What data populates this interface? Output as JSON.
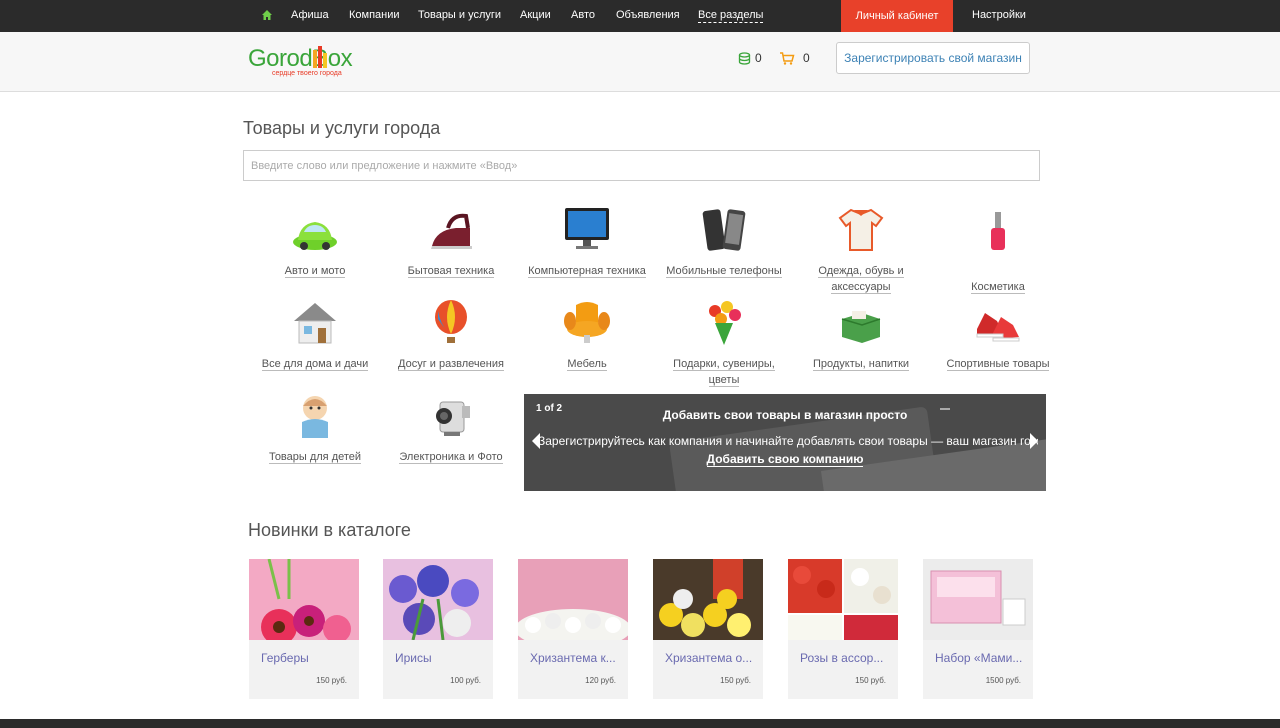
{
  "topnav": {
    "items": [
      "Афиша",
      "Компании",
      "Товары и услуги",
      "Акции",
      "Авто",
      "Объявления",
      "Все разделы"
    ],
    "cabinet": "Личный кабинет",
    "settings": "Настройки"
  },
  "header": {
    "logo_main": "GorodB",
    "logo_box": "ox",
    "logo_tagline": "сердце твоего города",
    "coins_count": "0",
    "cart_count": "0",
    "register_button": "Зарегистрировать свой магазин"
  },
  "main": {
    "title": "Товары и услуги города",
    "search_placeholder": "Введите слово или предложение и нажмите «Ввод»",
    "categories": [
      {
        "label": "Авто и мото",
        "icon": "car-icon"
      },
      {
        "label": "Бытовая техника",
        "icon": "iron-icon"
      },
      {
        "label": "Компьютерная техника",
        "icon": "monitor-icon"
      },
      {
        "label": "Мобильные телефоны",
        "icon": "phones-icon"
      },
      {
        "label": "Одежда, обувь и аксессуары",
        "icon": "shirt-icon"
      },
      {
        "label": "Косметика",
        "icon": "nail-polish-icon"
      },
      {
        "label": "Все для дома и дачи",
        "icon": "house-icon"
      },
      {
        "label": "Досуг и развлечения",
        "icon": "balloon-icon"
      },
      {
        "label": "Мебель",
        "icon": "armchair-icon"
      },
      {
        "label": "Подарки, сувениры, цветы",
        "icon": "bouquet-icon"
      },
      {
        "label": "Продукты, напитки",
        "icon": "grocery-box-icon"
      },
      {
        "label": "Спортивные товары",
        "icon": "sneakers-icon"
      },
      {
        "label": "Товары для детей",
        "icon": "baby-icon"
      },
      {
        "label": "Электроника и Фото",
        "icon": "camcorder-icon"
      }
    ]
  },
  "slider": {
    "page_label": "1  of  2",
    "title": "Добавить свои товары в магазин просто",
    "text": "Зарегистрируйтесь как компания и начинайте добавлять свои товары — ваш магазин готов",
    "link": "Добавить свою компанию"
  },
  "new_items": {
    "title": "Новинки в каталоге",
    "items": [
      {
        "name": "Герберы",
        "price": "150 руб."
      },
      {
        "name": "Ирисы",
        "price": "100 руб."
      },
      {
        "name": "Хризантема к...",
        "price": "120 руб."
      },
      {
        "name": "Хризантема о...",
        "price": "150 руб."
      },
      {
        "name": "Розы в ассор...",
        "price": "150 руб."
      },
      {
        "name": "Набор «Мами...",
        "price": "1500 руб."
      }
    ]
  },
  "colors": {
    "topbar": "#2b2b2b",
    "accent_red": "#e8412a",
    "logo_green": "#3aa53a",
    "link_blue": "#3d82b5"
  }
}
